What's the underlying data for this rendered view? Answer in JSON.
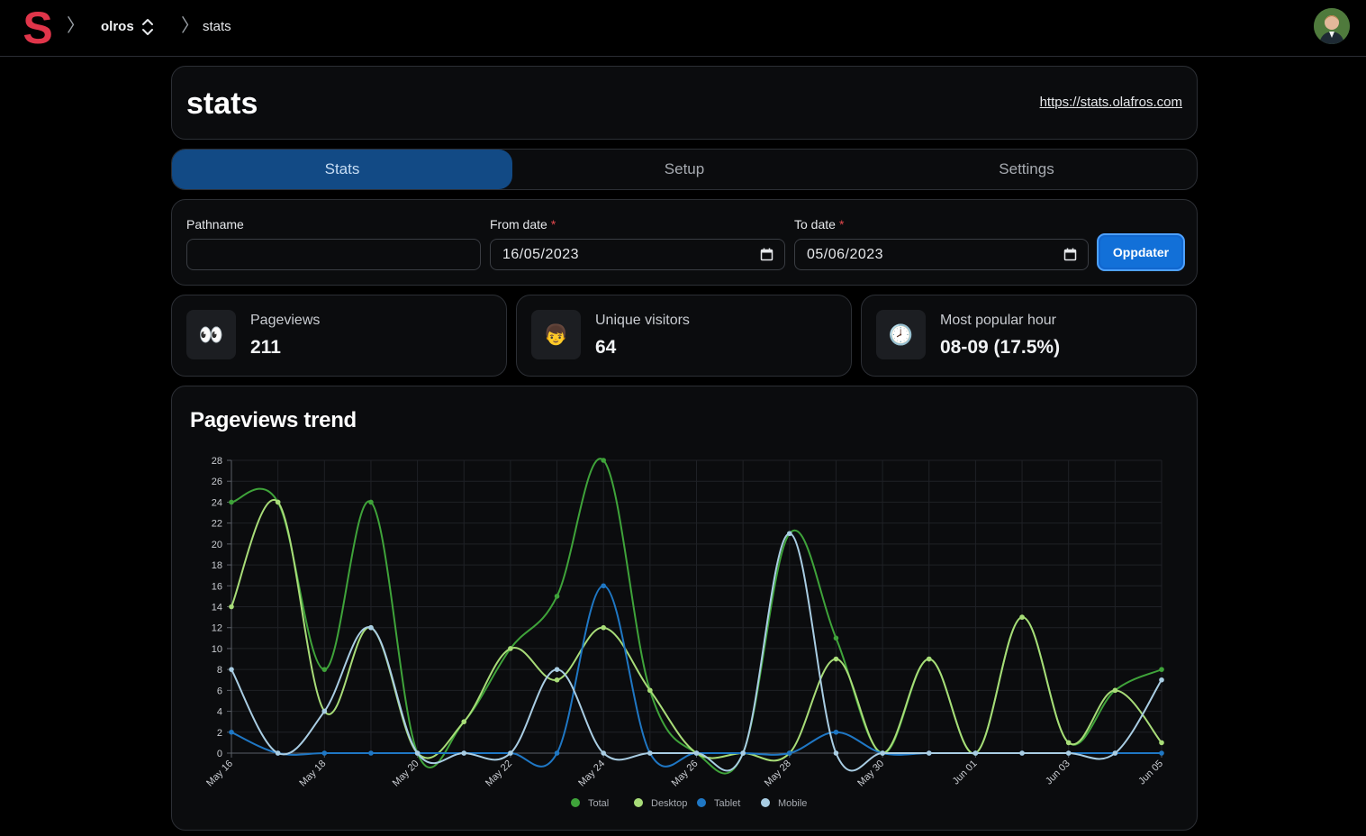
{
  "nav": {
    "logo_letter": "S",
    "org": "olros",
    "project": "stats",
    "separator": "〉"
  },
  "header": {
    "title": "stats",
    "url": "https://stats.olafros.com"
  },
  "tabs": [
    {
      "label": "Stats",
      "active": true
    },
    {
      "label": "Setup",
      "active": false
    },
    {
      "label": "Settings",
      "active": false
    }
  ],
  "filters": {
    "pathname_label": "Pathname",
    "pathname_value": "",
    "from_label": "From date",
    "from_value": "16/05/2023",
    "to_label": "To date",
    "to_value": "05/06/2023",
    "required_mark": "*",
    "submit_label": "Oppdater"
  },
  "stats": [
    {
      "icon": "👀",
      "icon_name": "eyes-icon",
      "label": "Pageviews",
      "value": "211"
    },
    {
      "icon": "👦",
      "icon_name": "person-icon",
      "label": "Unique visitors",
      "value": "64"
    },
    {
      "icon": "🕗",
      "icon_name": "clock-icon",
      "label": "Most popular hour",
      "value": "08-09 (17.5%)"
    }
  ],
  "chart_title": "Pageviews trend",
  "chart_data": {
    "type": "line",
    "x": [
      "May 16",
      "May 17",
      "May 18",
      "May 19",
      "May 20",
      "May 21",
      "May 22",
      "May 23",
      "May 24",
      "May 25",
      "May 26",
      "May 27",
      "May 28",
      "May 29",
      "May 30",
      "May 31",
      "Jun 01",
      "Jun 02",
      "Jun 03",
      "Jun 04",
      "Jun 05"
    ],
    "x_tick_labels": [
      "May 16",
      "May 18",
      "May 20",
      "May 22",
      "May 24",
      "May 26",
      "May 28",
      "May 30",
      "Jun 01",
      "Jun 03",
      "Jun 05"
    ],
    "ylim": [
      0,
      28
    ],
    "y_ticks": [
      0,
      2,
      4,
      6,
      8,
      10,
      12,
      14,
      16,
      18,
      20,
      22,
      24,
      26,
      28
    ],
    "grid": true,
    "legend_position": "bottom",
    "series": [
      {
        "name": "Total",
        "color": "#3fa33a",
        "values": [
          24,
          24,
          8,
          24,
          0,
          3,
          10,
          15,
          28,
          6,
          0,
          0,
          21,
          11,
          0,
          9,
          0,
          13,
          1,
          6,
          8
        ]
      },
      {
        "name": "Desktop",
        "color": "#a8dc78",
        "values": [
          14,
          24,
          4,
          12,
          0,
          3,
          10,
          7,
          12,
          6,
          0,
          0,
          0,
          9,
          0,
          9,
          0,
          13,
          1,
          6,
          1
        ]
      },
      {
        "name": "Tablet",
        "color": "#1f77c4",
        "values": [
          2,
          0,
          0,
          0,
          0,
          0,
          0,
          0,
          16,
          0,
          0,
          0,
          0,
          2,
          0,
          0,
          0,
          0,
          0,
          0,
          0
        ]
      },
      {
        "name": "Mobile",
        "color": "#a9cde3",
        "values": [
          8,
          0,
          4,
          12,
          0,
          0,
          0,
          8,
          0,
          0,
          0,
          0,
          21,
          0,
          0,
          0,
          0,
          0,
          0,
          0,
          7
        ]
      }
    ]
  }
}
